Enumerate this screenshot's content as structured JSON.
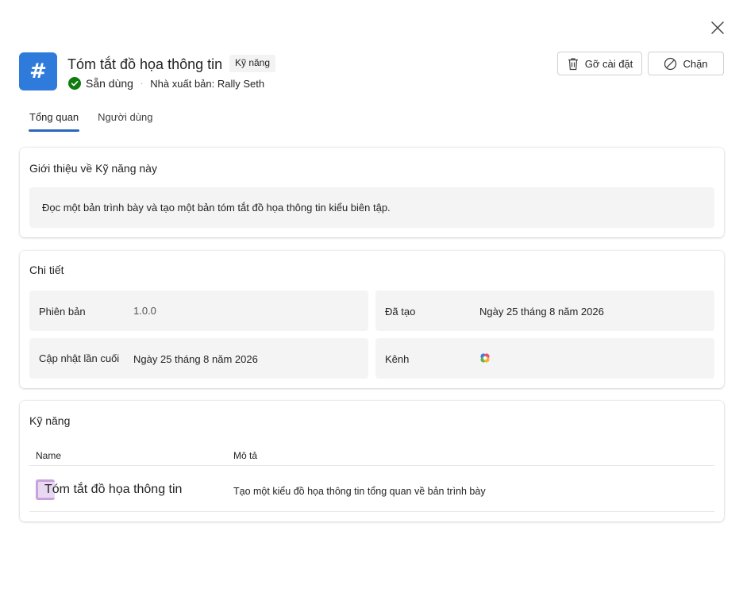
{
  "header": {
    "icon_glyph": "#",
    "title": "Tóm tắt đồ họa thông tin",
    "type_badge": "Kỹ năng",
    "status": "Sẵn dùng",
    "publisher": "Nhà xuất bản: Rally Seth",
    "accent_color": "#2f7bdc",
    "status_color": "#107c10"
  },
  "actions": {
    "uninstall_label": "Gỡ cài đặt",
    "block_label": "Chặn"
  },
  "tabs": [
    {
      "label": "Tổng quan",
      "active": true
    },
    {
      "label": "Người dùng",
      "active": false
    }
  ],
  "about": {
    "title": "Giới thiệu về Kỹ năng này",
    "description": "Đọc một bản trình bày và tạo một bản tóm tắt đồ họa thông tin kiểu biên tập."
  },
  "details": {
    "title": "Chi tiết",
    "version_label": "Phiên bản",
    "version_value": "1.0.0",
    "created_label": "Đã tạo",
    "created_value": "Ngày 25 tháng 8 năm 2026",
    "updated_label": "Cập nhật lần cuối",
    "updated_value": "Ngày 25 tháng 8 năm 2026",
    "channel_label": "Kênh",
    "channel_icon": "copilot-icon"
  },
  "skills": {
    "title": "Kỹ năng",
    "columns": {
      "name": "Name",
      "description": "Mô tả"
    },
    "rows": [
      {
        "name": "Tóm tắt đồ họa thông tin",
        "description": "Tạo một kiểu đồ họa thông tin tổng quan về bản trình bày"
      }
    ]
  }
}
